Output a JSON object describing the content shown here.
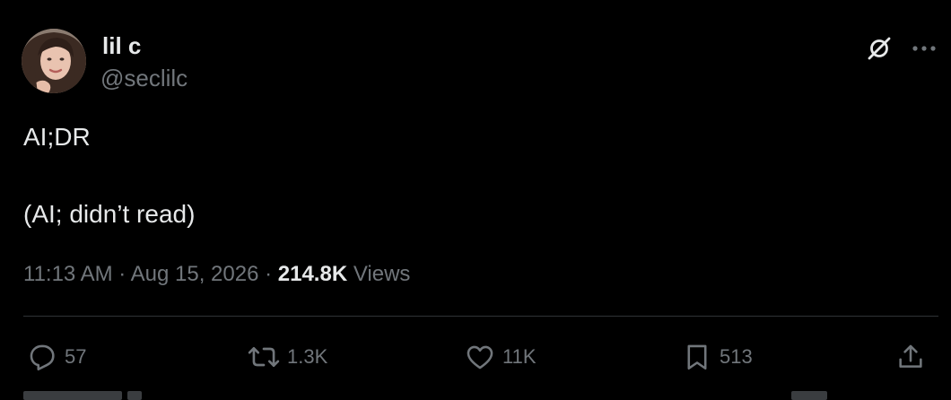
{
  "author": {
    "display_name": "lil c",
    "handle": "@seclilc",
    "avatar_icon": "avatar-photo"
  },
  "header_actions": {
    "grok_icon": "grok-slash-icon",
    "more_icon": "more-dots-icon"
  },
  "tweet": {
    "line1": "AI;DR",
    "line2": "(AI; didn’t read)"
  },
  "meta": {
    "time": "11:13 AM",
    "separator": " · ",
    "date": "Aug 15, 2026",
    "views_count": "214.8K",
    "views_label": " Views"
  },
  "actions": {
    "reply": {
      "icon": "reply-icon",
      "count": "57"
    },
    "retweet": {
      "icon": "retweet-icon",
      "count": "1.3K"
    },
    "like": {
      "icon": "heart-icon",
      "count": "11K"
    },
    "bookmark": {
      "icon": "bookmark-icon",
      "count": "513"
    },
    "share": {
      "icon": "share-icon"
    }
  },
  "colors": {
    "background": "#000000",
    "primary_text": "#e7e9ea",
    "secondary_text": "#71767b",
    "divider": "#2f3336"
  }
}
